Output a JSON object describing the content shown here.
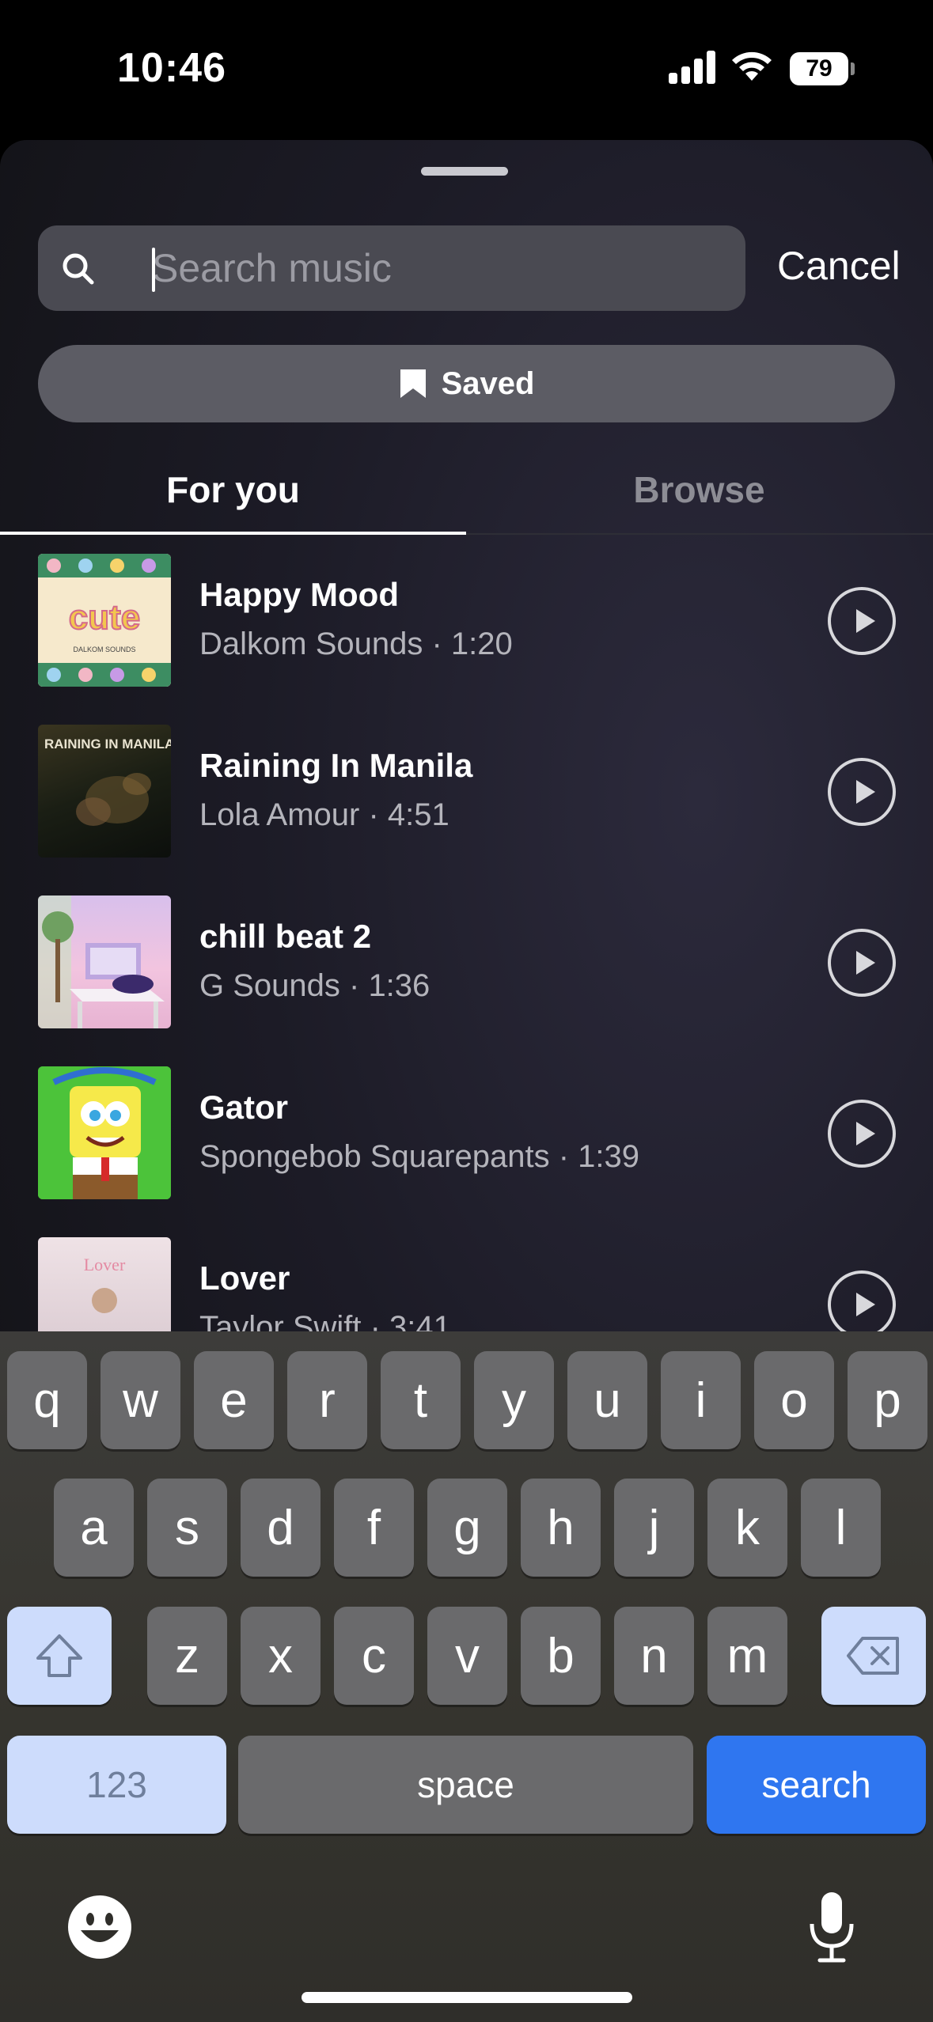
{
  "status_bar": {
    "time": "10:46",
    "battery": "79"
  },
  "search": {
    "placeholder": "Search music",
    "value": "",
    "cancel_label": "Cancel"
  },
  "saved_label": "Saved",
  "tabs": [
    {
      "label": "For you",
      "active": true
    },
    {
      "label": "Browse",
      "active": false
    }
  ],
  "tracks": [
    {
      "title": "Happy Mood",
      "subtitle": "Dalkom Sounds · 1:20",
      "art_text": "cute",
      "art_caption": "DALKOM SOUNDS"
    },
    {
      "title": "Raining In Manila",
      "subtitle": "Lola Amour · 4:51",
      "art_text": "RAINING IN MANILA"
    },
    {
      "title": "chill beat 2",
      "subtitle": "G Sounds · 1:36"
    },
    {
      "title": "Gator",
      "subtitle": "Spongebob Squarepants · 1:39"
    },
    {
      "title": "Lover",
      "subtitle": "Taylor Swift · 3:41",
      "art_text": "Lover"
    }
  ],
  "keyboard": {
    "row1": [
      "q",
      "w",
      "e",
      "r",
      "t",
      "y",
      "u",
      "i",
      "o",
      "p"
    ],
    "row2": [
      "a",
      "s",
      "d",
      "f",
      "g",
      "h",
      "j",
      "k",
      "l"
    ],
    "row3": [
      "z",
      "x",
      "c",
      "v",
      "b",
      "n",
      "m"
    ],
    "numbers_label": "123",
    "space_label": "space",
    "action_label": "search"
  },
  "colors": {
    "accent": "#2f76f0",
    "sheet": "#1c1b26",
    "key": "#6a6a6c"
  }
}
